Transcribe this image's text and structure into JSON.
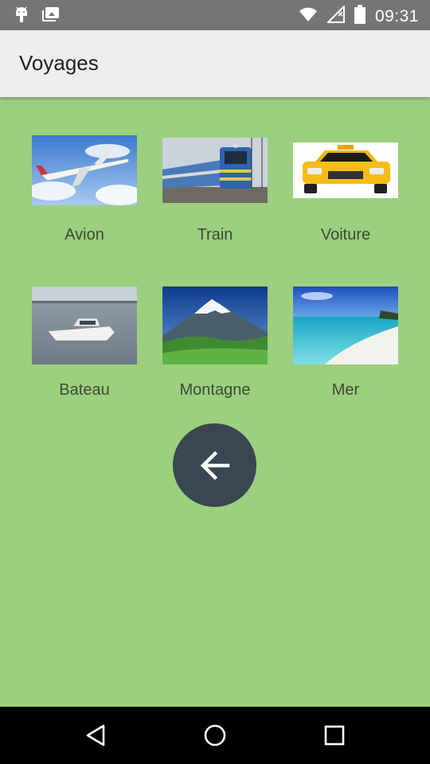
{
  "status_bar": {
    "time": "09:31",
    "icons": [
      "android-debug-icon",
      "photo-stack-icon",
      "wifi-icon",
      "signal-icon",
      "battery-icon"
    ]
  },
  "app_bar": {
    "title": "Voyages"
  },
  "items": [
    {
      "label": "Avion",
      "icon": "airplane-image"
    },
    {
      "label": "Train",
      "icon": "train-image"
    },
    {
      "label": "Voiture",
      "icon": "taxi-car-image"
    },
    {
      "label": "Bateau",
      "icon": "boat-image"
    },
    {
      "label": "Montagne",
      "icon": "mountain-image"
    },
    {
      "label": "Mer",
      "icon": "beach-sea-image"
    }
  ],
  "back_button": {
    "icon": "arrow-back-icon"
  },
  "navigation": {
    "buttons": [
      "back-triangle-icon",
      "home-circle-icon",
      "recents-square-icon"
    ]
  },
  "colors": {
    "background": "#9ccf7e",
    "app_bar": "#eeeeee",
    "fab": "#3a4650",
    "status_bar": "#757575"
  }
}
